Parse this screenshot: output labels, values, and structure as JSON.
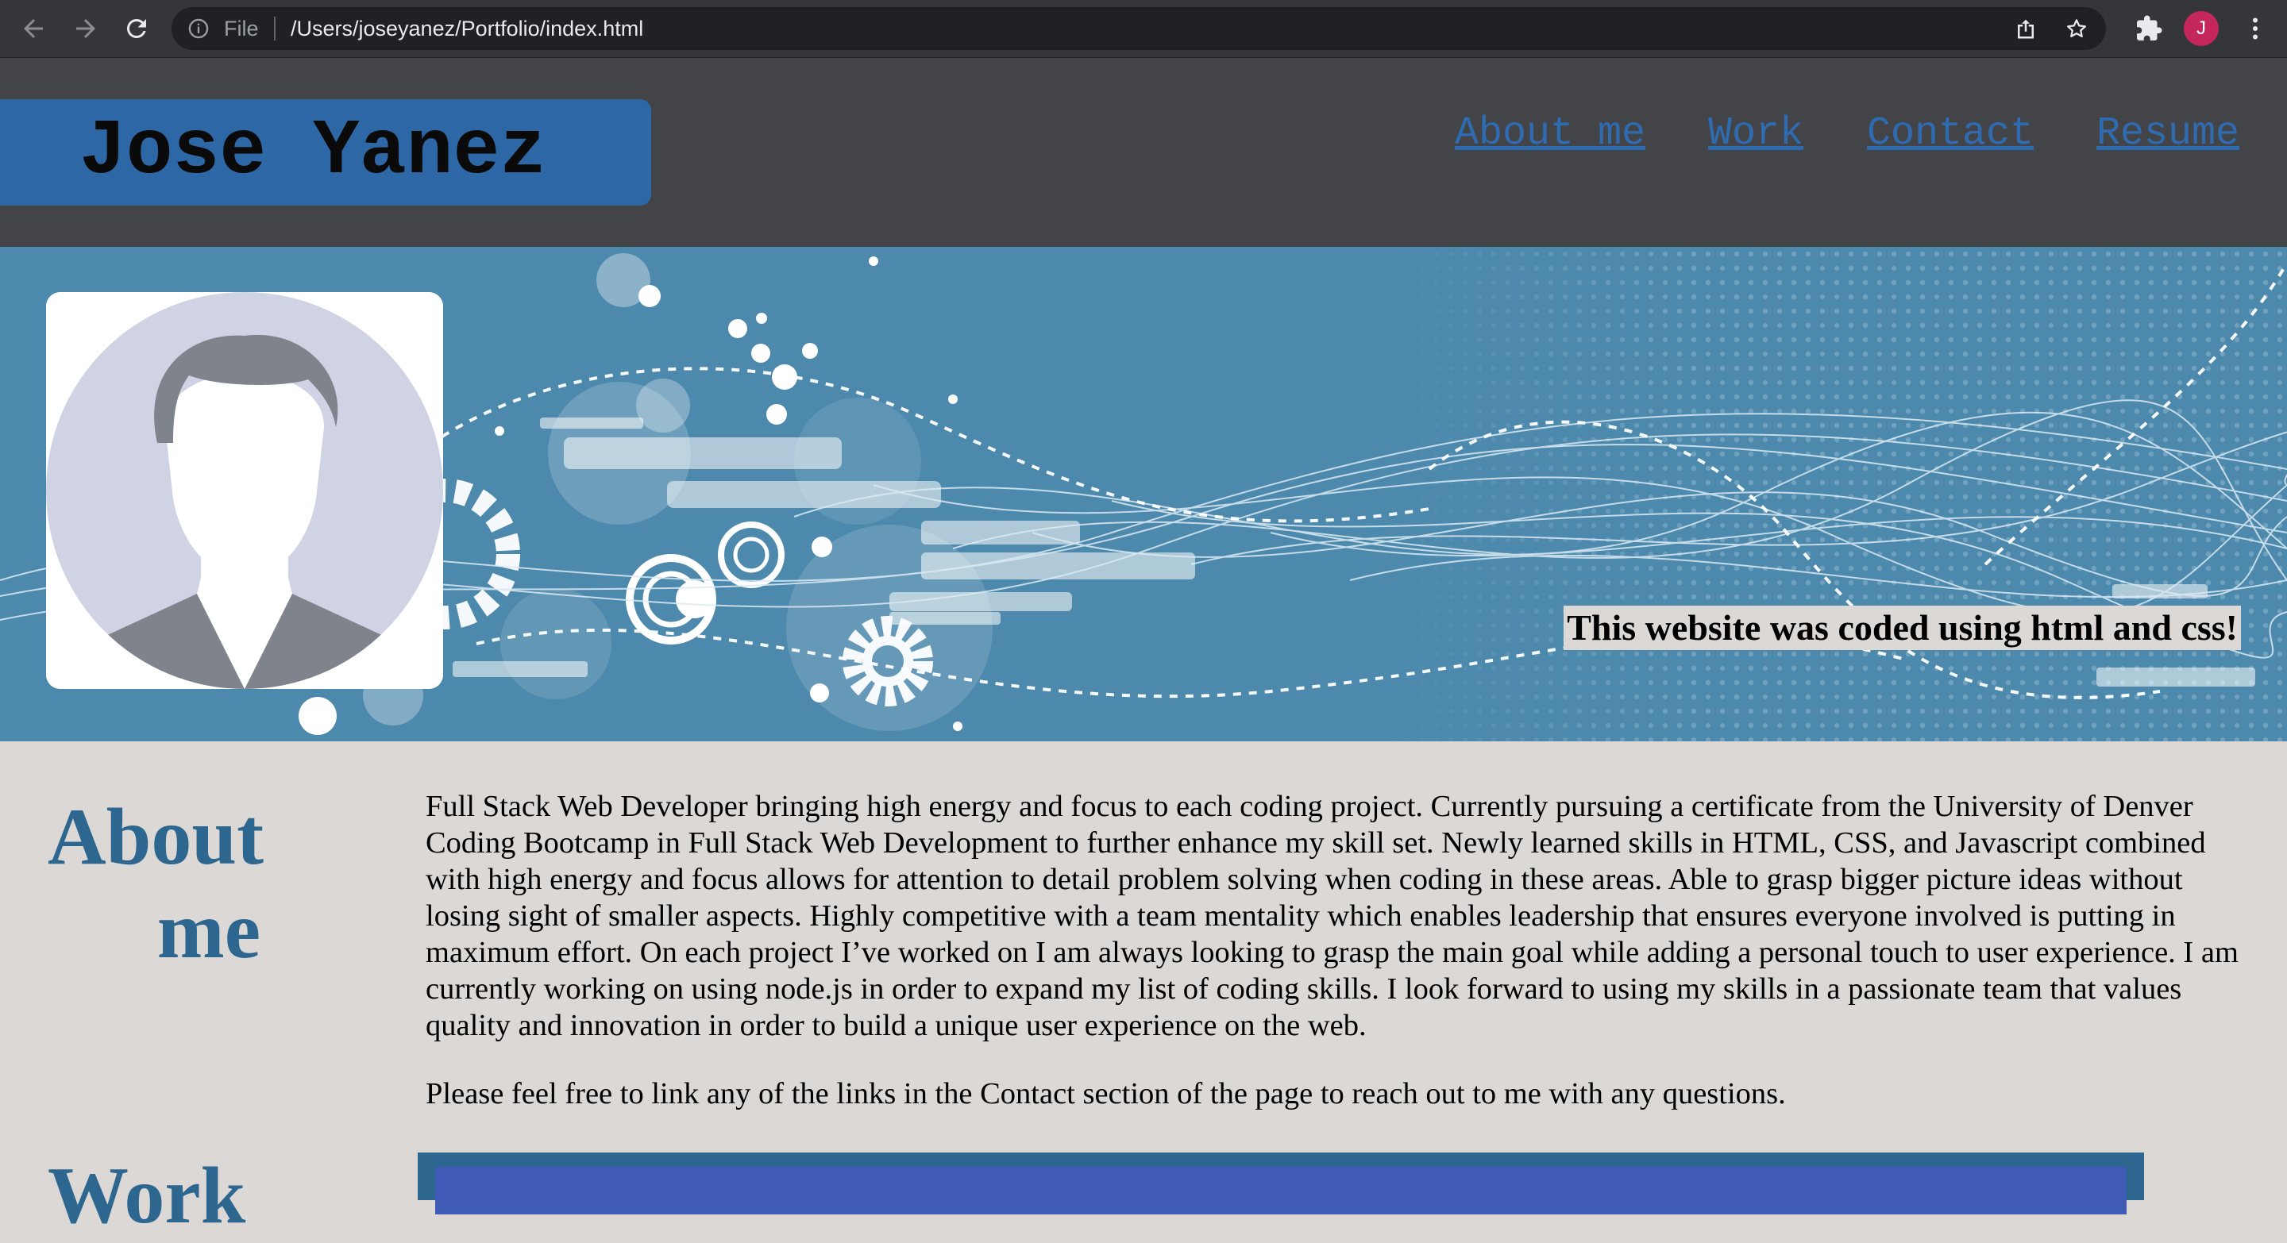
{
  "browser": {
    "scheme_label": "File",
    "url": "/Users/joseyanez/Portfolio/index.html",
    "profile_initial": "J",
    "profile_color": "#c5265b"
  },
  "header": {
    "name": "Jose Yanez",
    "nav": [
      {
        "label": "About me"
      },
      {
        "label": "Work"
      },
      {
        "label": "Contact"
      },
      {
        "label": "Resume"
      }
    ]
  },
  "hero": {
    "caption": "This website was coded using html and css!"
  },
  "about": {
    "title_line1": "About",
    "title_line2": "me",
    "paragraph1": "Full Stack Web Developer bringing high energy and focus to each coding project. Currently pursuing a certificate from the University of Denver Coding Bootcamp in Full Stack Web Development to further enhance my skill set. Newly learned skills in HTML, CSS, and Javascript combined with high energy and focus allows for attention to detail problem solving when coding in these areas. Able to grasp bigger picture ideas without losing sight of smaller aspects. Highly competitive with a team mentality which enables leadership that ensures everyone involved is putting in maximum effort. On each project I’ve worked on I am always looking to grasp the main goal while adding a personal touch to user experience. I am currently working on using node.js in order to expand my list of coding skills. I look forward to using my skills in a passionate team that values quality and innovation in order to build a unique user experience on the web.",
    "paragraph2": "Please feel free to link any of the links in the Contact section of the page to reach out to me with any questions."
  },
  "work": {
    "title": "Work"
  },
  "colors": {
    "page_bg": "#dcd8d5",
    "header_bg": "#434447",
    "name_box": "#2e67a5",
    "link": "#2e6bb0",
    "heading": "#2d6790",
    "hero_bg": "#4d89ac"
  }
}
